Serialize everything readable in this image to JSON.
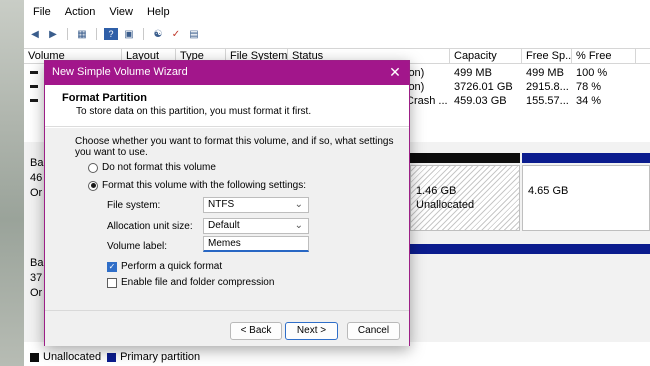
{
  "menu": [
    "File",
    "Action",
    "View",
    "Help"
  ],
  "toolbar_icons": [
    "back-arrow-icon",
    "forward-arrow-icon",
    "grid-icon",
    "help-icon",
    "panel-icon",
    "key-icon",
    "check-icon",
    "properties-icon"
  ],
  "columns": [
    "Volume",
    "Layout",
    "Type",
    "File System",
    "Status",
    "Capacity",
    "Free Sp...",
    "% Free"
  ],
  "volumes": [
    {
      "status": "ion)",
      "capacity": "499 MB",
      "free": "499 MB",
      "pct": "100 %"
    },
    {
      "status": "ion)",
      "capacity": "3726.01 GB",
      "free": "2915.8...",
      "pct": "78 %"
    },
    {
      "status": "Crash ...",
      "capacity": "459.03 GB",
      "free": "155.57...",
      "pct": "34 %"
    }
  ],
  "disks": [
    {
      "lines": [
        "Ba",
        "46",
        "Or"
      ]
    },
    {
      "lines": [
        "Ba",
        "37",
        "Or"
      ]
    }
  ],
  "partitions": [
    {
      "size": "1.46 GB",
      "label": "Unallocated"
    },
    {
      "size": "4.65 GB",
      "label": ""
    }
  ],
  "legend": [
    {
      "label": "Unallocated",
      "color": "#0c0c0c"
    },
    {
      "label": "Primary partition",
      "color": "#0b1c8e"
    }
  ],
  "wizard": {
    "title": "New Simple Volume Wizard",
    "heading": "Format Partition",
    "subheading": "To store data on this partition, you must format it first.",
    "intro": "Choose whether you want to format this volume, and if so, what settings you want to use.",
    "radio_no_format": "Do not format this volume",
    "radio_format": "Format this volume with the following settings:",
    "fs_label": "File system:",
    "fs_value": "NTFS",
    "alloc_label": "Allocation unit size:",
    "alloc_value": "Default",
    "vol_label": "Volume label:",
    "vol_value": "Memes",
    "quick_format": "Perform a quick format",
    "compression": "Enable file and folder compression",
    "back": "< Back",
    "next": "Next >",
    "cancel": "Cancel",
    "title_color": "#a2168b"
  }
}
